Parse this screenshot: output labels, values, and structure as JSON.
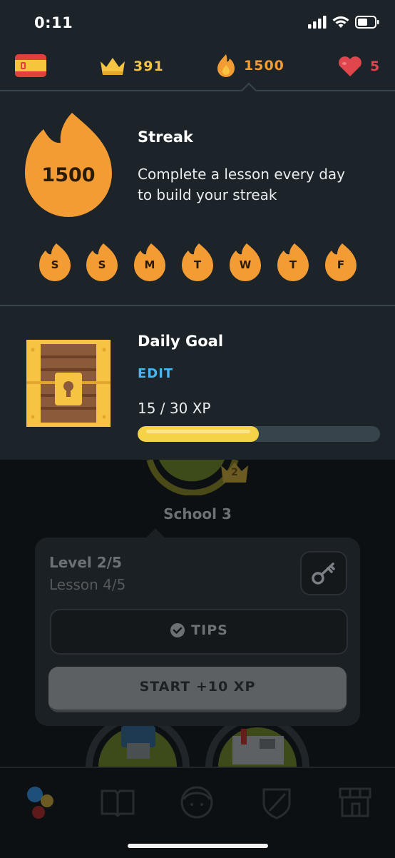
{
  "status_bar": {
    "time": "0:11"
  },
  "stats": {
    "crowns": "391",
    "streak": "1500",
    "hearts": "5"
  },
  "streak_panel": {
    "badge_value": "1500",
    "title": "Streak",
    "description_line1": "Complete a lesson every day",
    "description_line2": "to build your streak",
    "days": [
      "S",
      "S",
      "M",
      "T",
      "W",
      "T",
      "F"
    ]
  },
  "goal_panel": {
    "title": "Daily Goal",
    "edit_label": "EDIT",
    "progress_text": "15 / 30 XP",
    "progress_fraction": 0.5
  },
  "background": {
    "skill_name": "School 3",
    "skill_crown_level": "2",
    "level_text": "Level 2/5",
    "lesson_text": "Lesson 4/5",
    "tips_label": "TIPS",
    "start_label": "START +10 XP"
  },
  "colors": {
    "panel_bg": "#1c242a",
    "flame_orange": "#f39c34",
    "gold": "#f6c342",
    "heart_red": "#e0474c",
    "edit_blue": "#4ab6ef",
    "progress_fill": "#f6d246",
    "progress_track": "#37444c"
  }
}
